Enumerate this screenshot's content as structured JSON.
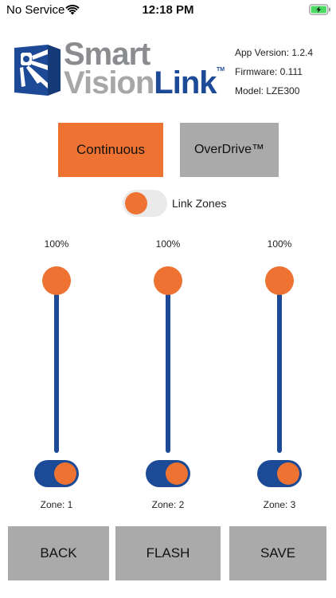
{
  "status_bar": {
    "carrier": "No Service",
    "time": "12:18 PM",
    "icons": [
      "wifi-icon",
      "battery-charging-icon"
    ]
  },
  "logo": {
    "line1": "Smart",
    "line2_part1": "Vision",
    "line2_part2": "Link",
    "tm": "TM",
    "brand_blue": "#1d4a97",
    "brand_gray": "#8a8c8f"
  },
  "info": {
    "app_version": "App Version: 1.2.4",
    "firmware": "Firmware: 0.111",
    "model": "Model: LZE300"
  },
  "modes": {
    "continuous_label": "Continuous",
    "overdrive_label": "OverDrive™",
    "selected": "Continuous",
    "active_color": "#ee7332",
    "inactive_color": "#aaaaaa"
  },
  "link_zones": {
    "label": "Link Zones",
    "on": false
  },
  "zones": [
    {
      "label": "Zone: 1",
      "level_text": "100%",
      "level": 1.0,
      "enabled": true
    },
    {
      "label": "Zone: 2",
      "level_text": "100%",
      "level": 1.0,
      "enabled": true
    },
    {
      "label": "Zone: 3",
      "level_text": "100%",
      "level": 1.0,
      "enabled": true
    }
  ],
  "buttons": {
    "back": "BACK",
    "flash": "FLASH",
    "save": "SAVE"
  }
}
